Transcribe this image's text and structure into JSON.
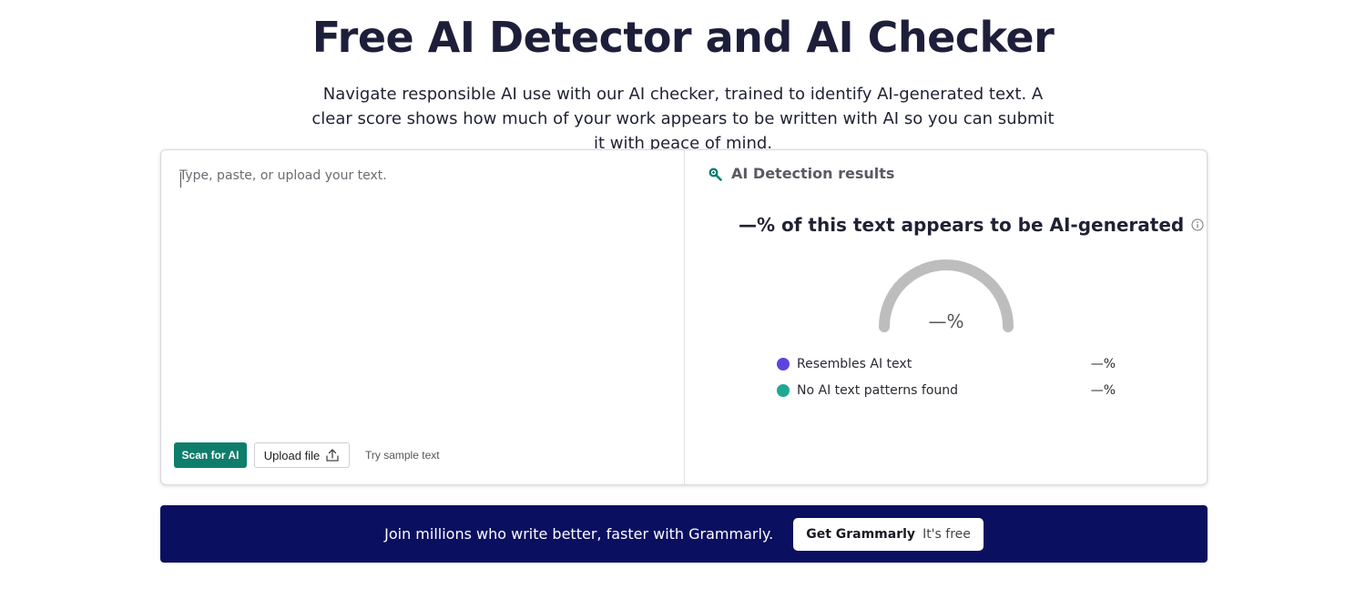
{
  "hero": {
    "title": "Free AI Detector and AI Checker",
    "subtitle": "Navigate responsible AI use with our AI checker, trained to identify AI-generated text. A clear score shows how much of your work appears to be written with AI so you can submit it with peace of mind."
  },
  "editor": {
    "placeholder": "Type, paste, or upload your text.",
    "value": "",
    "scan_label": "Scan for AI",
    "upload_label": "Upload file",
    "sample_label": "Try sample text"
  },
  "results": {
    "title": "AI Detection results",
    "headline": "—% of this text appears to be AI-generated",
    "gauge_value": "—%",
    "legend": [
      {
        "label": "Resembles AI text",
        "value": "—%",
        "color": "#5b45e0"
      },
      {
        "label": "No AI text patterns found",
        "value": "—%",
        "color": "#1fa893"
      }
    ]
  },
  "banner": {
    "text": "Join millions who write better, faster with Grammarly.",
    "button_main": "Get Grammarly",
    "button_sub": "It's free"
  },
  "colors": {
    "accent": "#0f7d6c",
    "banner_bg": "#0b0f60",
    "gauge_track": "#bdbdbd"
  },
  "icons": [
    "search-icon",
    "info-icon",
    "upload-icon"
  ]
}
